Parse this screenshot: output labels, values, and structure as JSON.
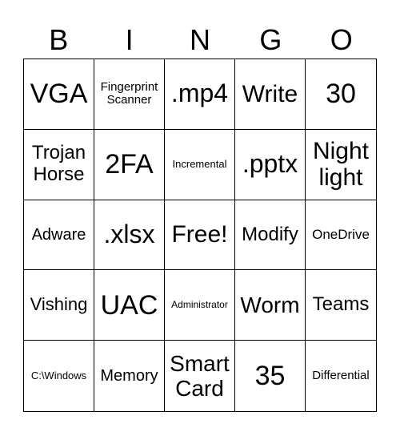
{
  "header": [
    "B",
    "I",
    "N",
    "G",
    "O"
  ],
  "cells": [
    "VGA",
    "Fingerprint Scanner",
    ".mp4",
    "Write",
    "30",
    "Trojan Horse",
    "2FA",
    "Incremental",
    ".pptx",
    "Night light",
    "Adware",
    ".xlsx",
    "Free!",
    "Modify",
    "OneDrive",
    "Vishing",
    "UAC",
    "Administrator",
    "Worm",
    "Teams",
    "C:\\Windows",
    "Memory",
    "Smart Card",
    "35",
    "Differential"
  ]
}
